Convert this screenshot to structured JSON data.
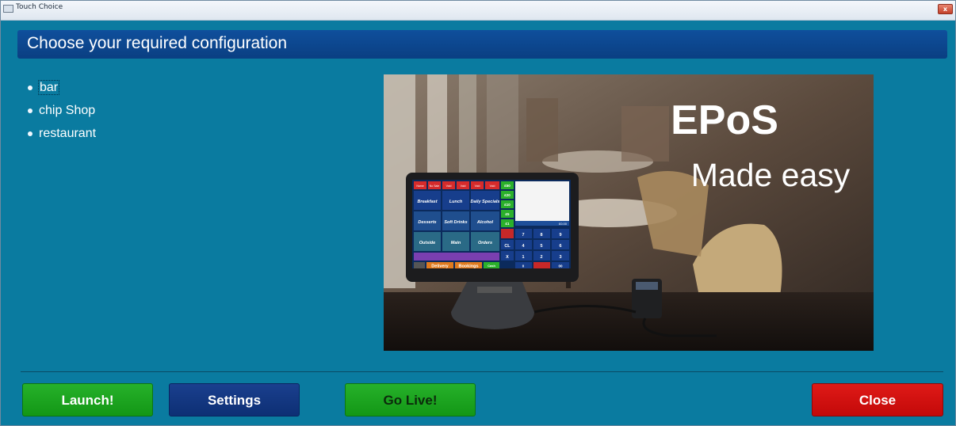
{
  "window": {
    "title": "Touch Choice",
    "close_glyph": "x"
  },
  "header": {
    "title": "Choose your required configuration"
  },
  "configurations": [
    {
      "label": "bar",
      "selected": true
    },
    {
      "label": "chip Shop",
      "selected": false
    },
    {
      "label": "restaurant",
      "selected": false
    }
  ],
  "promo": {
    "headline": "EPoS",
    "tagline": "Made easy",
    "screen": {
      "header_cells": [
        "Name",
        "No Sale",
        "Void",
        "Void",
        "Void",
        "Void"
      ],
      "menu": [
        [
          "Breakfast",
          "Lunch",
          "Daily Specials"
        ],
        [
          "Desserts",
          "Soft Drinks",
          "Alcohol"
        ],
        [
          "Outside",
          "Main",
          "Orders"
        ]
      ],
      "footer": [
        "Delivery",
        "Bookings",
        "Cash"
      ],
      "cash_keys": [
        "£50",
        "£20",
        "£10",
        "£5",
        "£1"
      ],
      "keypad": [
        "7",
        "8",
        "9",
        "4",
        "5",
        "6",
        "1",
        "2",
        "3",
        "0",
        "00"
      ],
      "side_keys": [
        "CL",
        "X"
      ],
      "display_total": "£0.00"
    }
  },
  "buttons": {
    "launch": "Launch!",
    "settings": "Settings",
    "golive": "Go Live!",
    "close": "Close"
  },
  "colors": {
    "background": "#0a7ba0",
    "header": "#0d4790",
    "launch": "#1da821",
    "settings": "#133781",
    "close": "#d10f0d"
  }
}
